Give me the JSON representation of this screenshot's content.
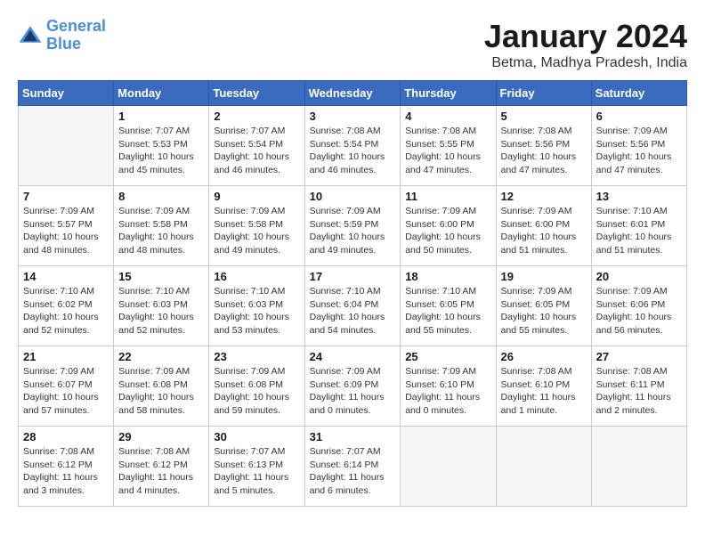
{
  "header": {
    "logo_line1": "General",
    "logo_line2": "Blue",
    "month": "January 2024",
    "location": "Betma, Madhya Pradesh, India"
  },
  "weekdays": [
    "Sunday",
    "Monday",
    "Tuesday",
    "Wednesday",
    "Thursday",
    "Friday",
    "Saturday"
  ],
  "weeks": [
    [
      {
        "day": "",
        "info": ""
      },
      {
        "day": "1",
        "info": "Sunrise: 7:07 AM\nSunset: 5:53 PM\nDaylight: 10 hours\nand 45 minutes."
      },
      {
        "day": "2",
        "info": "Sunrise: 7:07 AM\nSunset: 5:54 PM\nDaylight: 10 hours\nand 46 minutes."
      },
      {
        "day": "3",
        "info": "Sunrise: 7:08 AM\nSunset: 5:54 PM\nDaylight: 10 hours\nand 46 minutes."
      },
      {
        "day": "4",
        "info": "Sunrise: 7:08 AM\nSunset: 5:55 PM\nDaylight: 10 hours\nand 47 minutes."
      },
      {
        "day": "5",
        "info": "Sunrise: 7:08 AM\nSunset: 5:56 PM\nDaylight: 10 hours\nand 47 minutes."
      },
      {
        "day": "6",
        "info": "Sunrise: 7:09 AM\nSunset: 5:56 PM\nDaylight: 10 hours\nand 47 minutes."
      }
    ],
    [
      {
        "day": "7",
        "info": "Sunrise: 7:09 AM\nSunset: 5:57 PM\nDaylight: 10 hours\nand 48 minutes."
      },
      {
        "day": "8",
        "info": "Sunrise: 7:09 AM\nSunset: 5:58 PM\nDaylight: 10 hours\nand 48 minutes."
      },
      {
        "day": "9",
        "info": "Sunrise: 7:09 AM\nSunset: 5:58 PM\nDaylight: 10 hours\nand 49 minutes."
      },
      {
        "day": "10",
        "info": "Sunrise: 7:09 AM\nSunset: 5:59 PM\nDaylight: 10 hours\nand 49 minutes."
      },
      {
        "day": "11",
        "info": "Sunrise: 7:09 AM\nSunset: 6:00 PM\nDaylight: 10 hours\nand 50 minutes."
      },
      {
        "day": "12",
        "info": "Sunrise: 7:09 AM\nSunset: 6:00 PM\nDaylight: 10 hours\nand 51 minutes."
      },
      {
        "day": "13",
        "info": "Sunrise: 7:10 AM\nSunset: 6:01 PM\nDaylight: 10 hours\nand 51 minutes."
      }
    ],
    [
      {
        "day": "14",
        "info": "Sunrise: 7:10 AM\nSunset: 6:02 PM\nDaylight: 10 hours\nand 52 minutes."
      },
      {
        "day": "15",
        "info": "Sunrise: 7:10 AM\nSunset: 6:03 PM\nDaylight: 10 hours\nand 52 minutes."
      },
      {
        "day": "16",
        "info": "Sunrise: 7:10 AM\nSunset: 6:03 PM\nDaylight: 10 hours\nand 53 minutes."
      },
      {
        "day": "17",
        "info": "Sunrise: 7:10 AM\nSunset: 6:04 PM\nDaylight: 10 hours\nand 54 minutes."
      },
      {
        "day": "18",
        "info": "Sunrise: 7:10 AM\nSunset: 6:05 PM\nDaylight: 10 hours\nand 55 minutes."
      },
      {
        "day": "19",
        "info": "Sunrise: 7:09 AM\nSunset: 6:05 PM\nDaylight: 10 hours\nand 55 minutes."
      },
      {
        "day": "20",
        "info": "Sunrise: 7:09 AM\nSunset: 6:06 PM\nDaylight: 10 hours\nand 56 minutes."
      }
    ],
    [
      {
        "day": "21",
        "info": "Sunrise: 7:09 AM\nSunset: 6:07 PM\nDaylight: 10 hours\nand 57 minutes."
      },
      {
        "day": "22",
        "info": "Sunrise: 7:09 AM\nSunset: 6:08 PM\nDaylight: 10 hours\nand 58 minutes."
      },
      {
        "day": "23",
        "info": "Sunrise: 7:09 AM\nSunset: 6:08 PM\nDaylight: 10 hours\nand 59 minutes."
      },
      {
        "day": "24",
        "info": "Sunrise: 7:09 AM\nSunset: 6:09 PM\nDaylight: 11 hours\nand 0 minutes."
      },
      {
        "day": "25",
        "info": "Sunrise: 7:09 AM\nSunset: 6:10 PM\nDaylight: 11 hours\nand 0 minutes."
      },
      {
        "day": "26",
        "info": "Sunrise: 7:08 AM\nSunset: 6:10 PM\nDaylight: 11 hours\nand 1 minute."
      },
      {
        "day": "27",
        "info": "Sunrise: 7:08 AM\nSunset: 6:11 PM\nDaylight: 11 hours\nand 2 minutes."
      }
    ],
    [
      {
        "day": "28",
        "info": "Sunrise: 7:08 AM\nSunset: 6:12 PM\nDaylight: 11 hours\nand 3 minutes."
      },
      {
        "day": "29",
        "info": "Sunrise: 7:08 AM\nSunset: 6:12 PM\nDaylight: 11 hours\nand 4 minutes."
      },
      {
        "day": "30",
        "info": "Sunrise: 7:07 AM\nSunset: 6:13 PM\nDaylight: 11 hours\nand 5 minutes."
      },
      {
        "day": "31",
        "info": "Sunrise: 7:07 AM\nSunset: 6:14 PM\nDaylight: 11 hours\nand 6 minutes."
      },
      {
        "day": "",
        "info": ""
      },
      {
        "day": "",
        "info": ""
      },
      {
        "day": "",
        "info": ""
      }
    ]
  ]
}
